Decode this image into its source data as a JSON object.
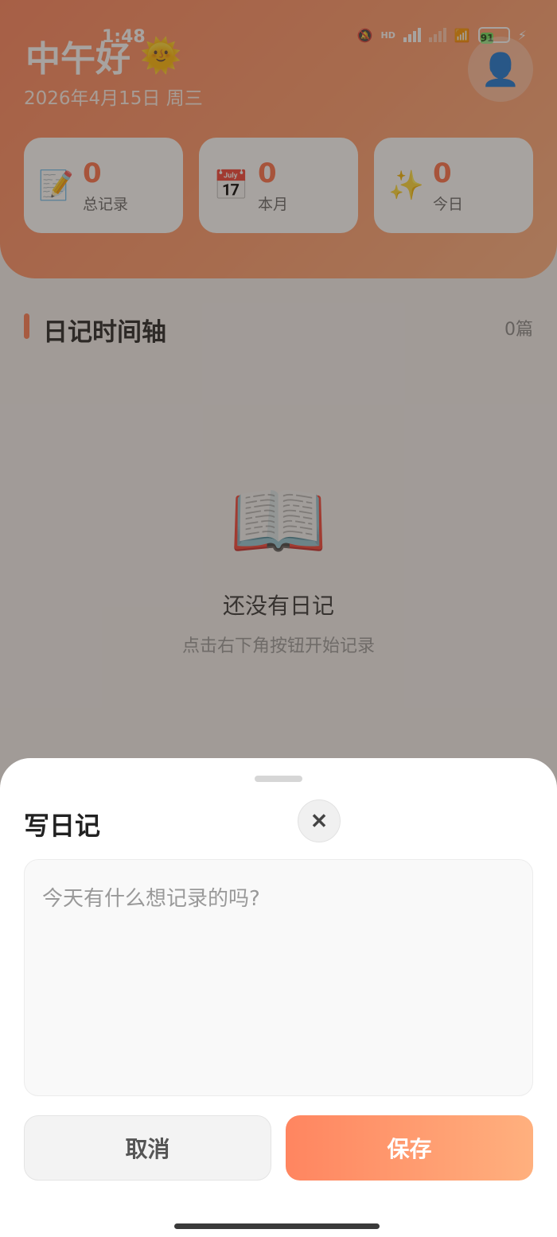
{
  "status_bar": {
    "time": "1:48",
    "network_badge": "HD",
    "battery_level": "91"
  },
  "header": {
    "greeting": "中午好",
    "greeting_icon": "sun-icon",
    "date": "2026年4月15日 周三",
    "avatar_icon": "user-avatar-icon"
  },
  "stats": [
    {
      "icon": "memo-icon",
      "value": "0",
      "label": "总记录"
    },
    {
      "icon": "calendar-icon",
      "value": "0",
      "label": "本月"
    },
    {
      "icon": "sparkles-icon",
      "value": "0",
      "label": "今日"
    }
  ],
  "timeline": {
    "title": "日记时间轴",
    "count": "0篇"
  },
  "empty_state": {
    "icon": "open-book-icon",
    "title": "还没有日记",
    "subtitle": "点击右下角按钮开始记录"
  },
  "sheet": {
    "title": "写日记",
    "close_symbol": "✕",
    "editor_placeholder": "今天有什么想记录的吗?",
    "editor_value": "",
    "cancel_label": "取消",
    "save_label": "保存"
  },
  "colors": {
    "accent": "#ff7d52",
    "header_gradient_start": "#ff845c",
    "header_gradient_end": "#ffb07f",
    "stat_value": "#ff6f47"
  }
}
